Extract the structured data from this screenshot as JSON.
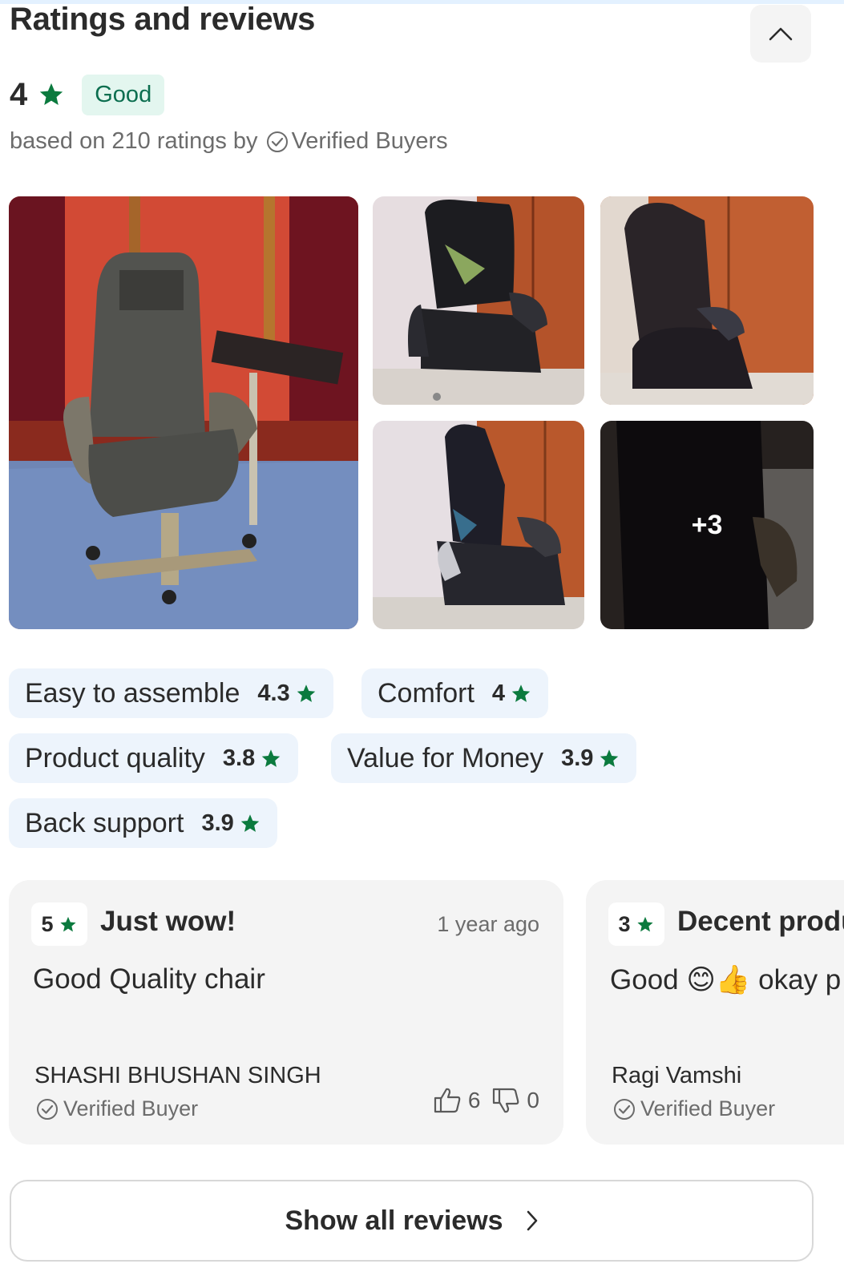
{
  "section": {
    "title": "Ratings and reviews"
  },
  "summary": {
    "rating": "4",
    "label": "Good",
    "based_on_prefix": "based on 210 ratings by",
    "verified_label": "Verified Buyers"
  },
  "photos": {
    "more_count": "+3"
  },
  "attributes": [
    {
      "name": "Easy to assemble",
      "score": "4.3"
    },
    {
      "name": "Comfort",
      "score": "4"
    },
    {
      "name": "Product quality",
      "score": "3.8"
    },
    {
      "name": "Value for Money",
      "score": "3.9"
    },
    {
      "name": "Back support",
      "score": "3.9"
    }
  ],
  "reviews": [
    {
      "rating": "5",
      "headline": "Just wow!",
      "time": "1 year ago",
      "body": "Good Quality chair",
      "author": "SHASHI BHUSHAN SINGH",
      "verified": "Verified Buyer",
      "likes": "6",
      "dislikes": "0"
    },
    {
      "rating": "3",
      "headline": "Decent produ",
      "body": "Good 😊👍 okay p",
      "author": "Ragi Vamshi",
      "verified": "Verified Buyer"
    }
  ],
  "footer": {
    "show_all_label": "Show all reviews"
  },
  "colors": {
    "star": "#0b7a3e",
    "badge_bg": "#e3f6ef",
    "chip_bg": "#edf4fc",
    "card_bg": "#f4f4f4"
  }
}
